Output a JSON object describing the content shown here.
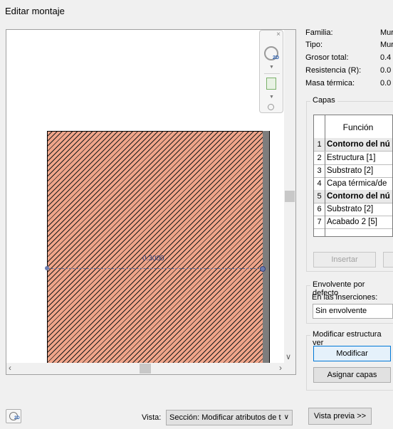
{
  "window": {
    "title": "Editar montaje"
  },
  "preview": {
    "dimension_text": "0.3000",
    "navbar_close": "×",
    "navbar_2d": "2D"
  },
  "properties": [
    {
      "label": "Familia:",
      "value": "Mur"
    },
    {
      "label": "Tipo:",
      "value": "Mur"
    },
    {
      "label": "Grosor total:",
      "value": "0.4"
    },
    {
      "label": "Resistencia (R):",
      "value": "0.0"
    },
    {
      "label": "Masa térmica:",
      "value": "0.0"
    }
  ],
  "layers": {
    "legend": "Capas",
    "column_header": "Función",
    "rows": [
      {
        "n": "1",
        "text": "Contorno del nú",
        "bold": true
      },
      {
        "n": "2",
        "text": "Estructura [1]",
        "bold": false
      },
      {
        "n": "3",
        "text": "Substrato [2]",
        "bold": false
      },
      {
        "n": "4",
        "text": "Capa térmica/de",
        "bold": false
      },
      {
        "n": "5",
        "text": "Contorno del nú",
        "bold": true
      },
      {
        "n": "6",
        "text": "Substrato [2]",
        "bold": false
      },
      {
        "n": "7",
        "text": "Acabado 2 [5]",
        "bold": false
      }
    ],
    "insert_button": "Insertar"
  },
  "wrapping": {
    "legend": "Envolvente por defecto",
    "at_inserts_label": "En las inserciones:",
    "at_inserts_value": "Sin envolvente"
  },
  "modify_structure": {
    "legend": "Modificar estructura ver",
    "modify_button": "Modificar",
    "assign_layers_button": "Asignar capas"
  },
  "footer": {
    "view_label": "Vista:",
    "view_value": "Sección: Modificar atributos de t",
    "preview_button": "Vista previa >>",
    "icon_2d": "2D"
  }
}
